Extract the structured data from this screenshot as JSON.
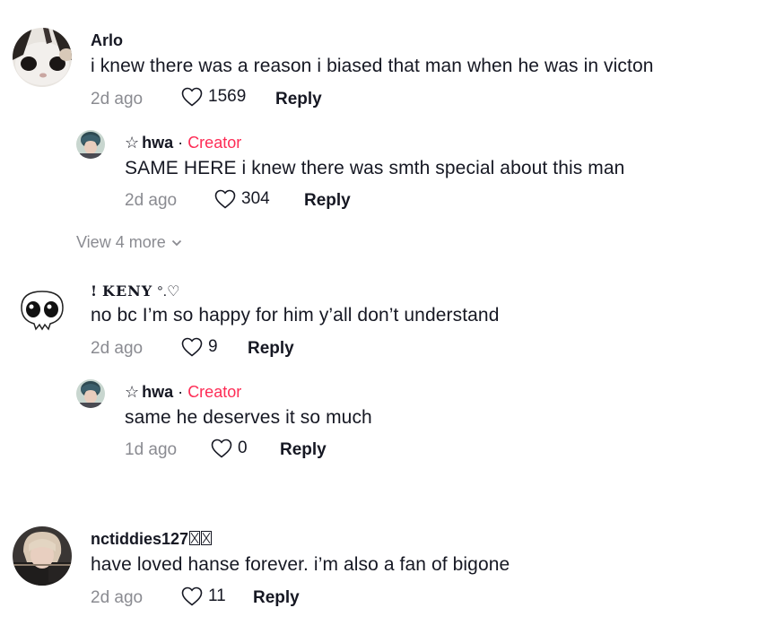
{
  "comments": [
    {
      "username": "Arlo",
      "text": "i knew there was a reason i biased that man when he was in victon",
      "time": "2d ago",
      "likes": "1569",
      "reply_label": "Reply",
      "replies": [
        {
          "star": "☆",
          "username": "hwa",
          "separator": "·",
          "badge": "Creator",
          "text": "SAME HERE i knew there was smth special about this man",
          "time": "2d ago",
          "likes": "304",
          "reply_label": "Reply"
        }
      ],
      "view_more": "View 4 more"
    },
    {
      "username_prefix": "!",
      "username": "KENY",
      "username_suffix": "°.♡",
      "text": "no bc I’m so happy for him y’all don’t understand",
      "time": "2d ago",
      "likes": "9",
      "reply_label": "Reply",
      "replies": [
        {
          "star": "☆",
          "username": "hwa",
          "separator": "·",
          "badge": "Creator",
          "text": "same he deserves it so much",
          "time": "1d ago",
          "likes": "0",
          "reply_label": "Reply"
        }
      ]
    },
    {
      "username": "nctiddies127",
      "text": "have loved hanse forever. i’m also a fan of bigone",
      "time": "2d ago",
      "likes": "11",
      "reply_label": "Reply"
    }
  ],
  "colors": {
    "creator_badge": "#fe2c55",
    "muted_text": "#8a8b91",
    "primary_text": "#161823"
  },
  "icons": {
    "like": "heart-outline-icon",
    "expand": "chevron-down-icon"
  }
}
